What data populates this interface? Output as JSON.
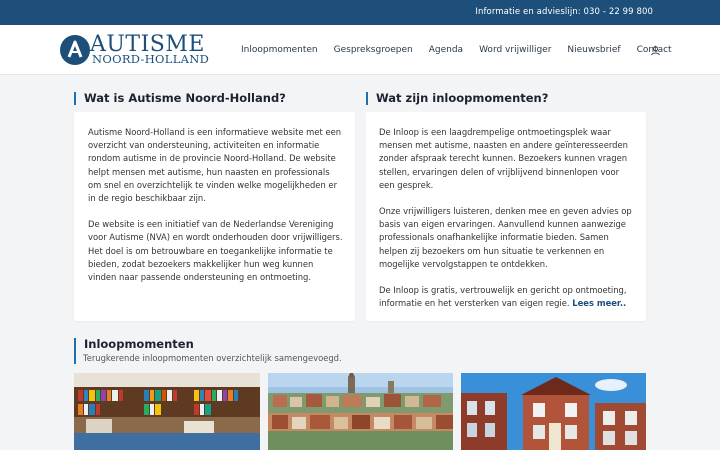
{
  "topbar": {
    "info": "Informatie en advieslijn: 030 - 22 99 800"
  },
  "logo": {
    "title": "AUTISME",
    "subtitle": "NOORD-HOLLAND"
  },
  "nav": [
    "Inloopmomenten",
    "Gespreksgroepen",
    "Agenda",
    "Word vrijwilliger",
    "Nieuwsbrief",
    "Contact"
  ],
  "left": {
    "heading": "Wat is Autisme Noord-Holland?",
    "p1": "Autisme Noord-Holland is een informatieve website met een overzicht van ondersteuning, activiteiten en informatie rondom autisme in de provincie Noord-Holland. De website helpt mensen met autisme, hun naasten en professionals om snel en overzichtelijk te vinden welke mogelijkheden er in de regio beschikbaar zijn.",
    "p2": "De website is een initiatief van de Nederlandse Vereniging voor Autisme (NVA) en wordt onderhouden door vrijwilligers. Het doel is om betrouwbare en toegankelijke informatie te bieden, zodat bezoekers makkelijker hun weg kunnen vinden naar passende ondersteuning en ontmoeting."
  },
  "right": {
    "heading": "Wat zijn inloopmomenten?",
    "p1": "De Inloop is een laagdrempelige ontmoetingsplek waar mensen met autisme, naasten en andere geïnteresseerden zonder afspraak terecht kunnen. Bezoekers kunnen vragen stellen, ervaringen delen of vrijblijvend binnenlopen voor een gesprek.",
    "p2": "Onze vrijwilligers luisteren, denken mee en geven advies op basis van eigen ervaringen. Aanvullend kunnen aanwezige professionals onafhankelijke informatie bieden. Samen helpen zij bezoekers om hun situatie te verkennen en mogelijke vervolgstappen te ontdekken.",
    "p3": "De Inloop is gratis, vertrouwelijk en gericht op ontmoeting, informatie en het versterken van eigen regie.",
    "read_more": "Lees meer.."
  },
  "inloop": {
    "heading": "Inloopmomenten",
    "subtitle": "Terugkerende inloopmomenten overzichtelijk samengevoegd."
  },
  "colors": {
    "primary": "#1d4f7a",
    "accent": "#1d6fb0"
  }
}
